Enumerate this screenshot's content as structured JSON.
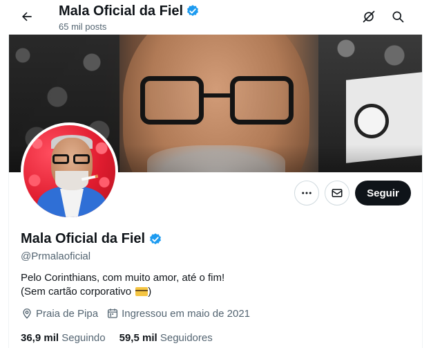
{
  "header": {
    "title": "Mala Oficial da Fiel",
    "subtitle": "65 mil posts"
  },
  "profile": {
    "name": "Mala Oficial da Fiel",
    "handle": "@Prmalaoficial",
    "bio_line1": "Pelo Corinthians, com muito amor, até o fim!",
    "bio_line2": "(Sem cartão corporativo",
    "bio_line2_end": ")",
    "location": "Praia de Pipa",
    "joined": "Ingressou em maio de 2021",
    "verified_color": "#1d9bf0"
  },
  "actions": {
    "follow_label": "Seguir"
  },
  "stats": {
    "following_count": "36,9 mil",
    "following_label": "Seguindo",
    "followers_count": "59,5 mil",
    "followers_label": "Seguidores"
  },
  "icons": {
    "back": "arrow-left-icon",
    "grok": "grok-icon",
    "search": "search-icon",
    "more": "more-dots-icon",
    "message": "envelope-icon",
    "verified": "verified-badge-icon",
    "location": "location-pin-icon",
    "calendar": "calendar-icon",
    "card": "credit-card-emoji"
  }
}
